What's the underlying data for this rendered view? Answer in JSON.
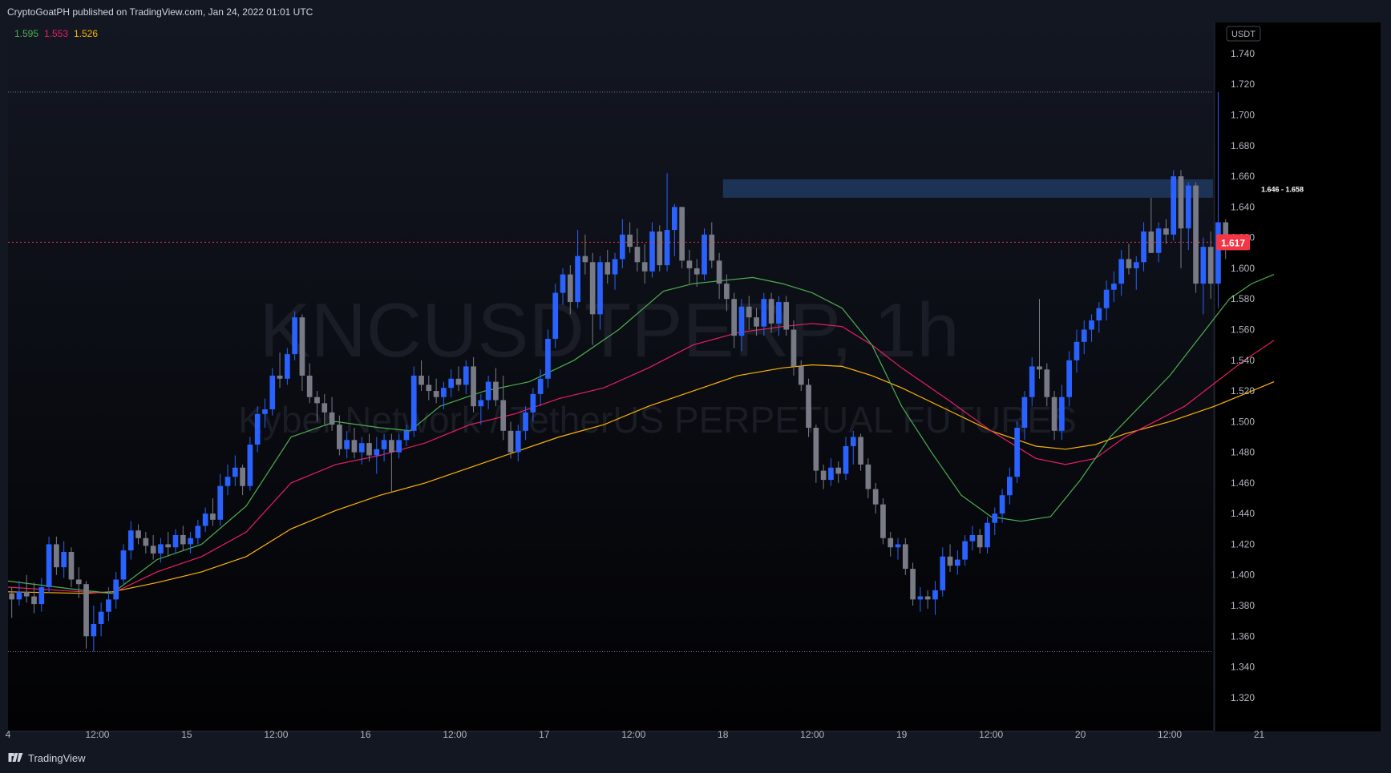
{
  "header": {
    "published_text": "CryptoGoatPH published on TradingView.com, Jan 24, 2022 01:01 UTC"
  },
  "footer": {
    "brand": "TradingView",
    "logo_icon": "tradingview-logo-icon"
  },
  "colors": {
    "background": "#000000",
    "up_candle": "#2962ff",
    "down_candle": "#787b86",
    "ema_fast": "#4caf50",
    "ema_mid": "#e91e63",
    "ema_slow": "#ffb300",
    "price_line": "#f23645",
    "zone": "#1e3a5f"
  },
  "chart_data": {
    "type": "candlestick",
    "watermark_symbol": "KNCUSDTPERP, 1h",
    "watermark_description": "Kyber Network / TetherUS PERPETUAL FUTURES",
    "currency": "USDT",
    "ylim": [
      1.31,
      1.752
    ],
    "y_ticks": [
      "1.740",
      "1.720",
      "1.700",
      "1.680",
      "1.660",
      "1.640",
      "1.620",
      "1.600",
      "1.580",
      "1.560",
      "1.540",
      "1.520",
      "1.500",
      "1.480",
      "1.460",
      "1.440",
      "1.420",
      "1.400",
      "1.380",
      "1.360",
      "1.340",
      "1.320"
    ],
    "x_ticks": [
      {
        "label": "4",
        "hour": 0
      },
      {
        "label": "12:00",
        "hour": 12
      },
      {
        "label": "15",
        "hour": 24
      },
      {
        "label": "12:00",
        "hour": 36
      },
      {
        "label": "16",
        "hour": 48
      },
      {
        "label": "12:00",
        "hour": 60
      },
      {
        "label": "17",
        "hour": 72
      },
      {
        "label": "12:00",
        "hour": 84
      },
      {
        "label": "18",
        "hour": 96
      },
      {
        "label": "12:00",
        "hour": 108
      },
      {
        "label": "19",
        "hour": 120
      },
      {
        "label": "12:00",
        "hour": 132
      },
      {
        "label": "20",
        "hour": 144
      },
      {
        "label": "12:00",
        "hour": 156
      },
      {
        "label": "21",
        "hour": 168
      }
    ],
    "x_range_hours": [
      0,
      180
    ],
    "ema_values": [
      {
        "name": "EMA fast",
        "value": "1.595",
        "color": "#4caf50"
      },
      {
        "name": "EMA mid",
        "value": "1.553",
        "color": "#e91e63"
      },
      {
        "name": "EMA slow",
        "value": "1.526",
        "color": "#ffb300"
      }
    ],
    "last_price": {
      "label": "1.617",
      "value": 1.617
    },
    "zone": {
      "label": "1.646 - 1.658",
      "low": 1.646,
      "high": 1.658,
      "start_hour": 96
    },
    "dotted_levels": [
      1.715,
      1.35
    ],
    "candles": [
      [
        1.388,
        1.392,
        1.372,
        1.384
      ],
      [
        1.384,
        1.396,
        1.38,
        1.389
      ],
      [
        1.389,
        1.4,
        1.382,
        1.386
      ],
      [
        1.386,
        1.395,
        1.375,
        1.381
      ],
      [
        1.381,
        1.398,
        1.376,
        1.392
      ],
      [
        1.392,
        1.425,
        1.388,
        1.42
      ],
      [
        1.42,
        1.425,
        1.4,
        1.405
      ],
      [
        1.405,
        1.422,
        1.398,
        1.415
      ],
      [
        1.415,
        1.418,
        1.392,
        1.397
      ],
      [
        1.397,
        1.405,
        1.385,
        1.394
      ],
      [
        1.394,
        1.396,
        1.352,
        1.36
      ],
      [
        1.36,
        1.38,
        1.35,
        1.368
      ],
      [
        1.368,
        1.382,
        1.36,
        1.376
      ],
      [
        1.376,
        1.392,
        1.37,
        1.384
      ],
      [
        1.384,
        1.402,
        1.378,
        1.397
      ],
      [
        1.397,
        1.42,
        1.394,
        1.416
      ],
      [
        1.416,
        1.435,
        1.41,
        1.429
      ],
      [
        1.429,
        1.433,
        1.42,
        1.424
      ],
      [
        1.424,
        1.428,
        1.414,
        1.419
      ],
      [
        1.419,
        1.426,
        1.41,
        1.414
      ],
      [
        1.414,
        1.424,
        1.408,
        1.42
      ],
      [
        1.42,
        1.428,
        1.412,
        1.418
      ],
      [
        1.418,
        1.43,
        1.414,
        1.426
      ],
      [
        1.426,
        1.432,
        1.416,
        1.42
      ],
      [
        1.42,
        1.428,
        1.414,
        1.424
      ],
      [
        1.424,
        1.436,
        1.42,
        1.432
      ],
      [
        1.432,
        1.444,
        1.428,
        1.44
      ],
      [
        1.44,
        1.45,
        1.432,
        1.436
      ],
      [
        1.436,
        1.466,
        1.432,
        1.458
      ],
      [
        1.458,
        1.472,
        1.452,
        1.464
      ],
      [
        1.464,
        1.478,
        1.458,
        1.47
      ],
      [
        1.47,
        1.472,
        1.452,
        1.458
      ],
      [
        1.458,
        1.49,
        1.455,
        1.485
      ],
      [
        1.485,
        1.51,
        1.48,
        1.505
      ],
      [
        1.505,
        1.515,
        1.496,
        1.508
      ],
      [
        1.508,
        1.535,
        1.504,
        1.53
      ],
      [
        1.53,
        1.545,
        1.522,
        1.528
      ],
      [
        1.528,
        1.548,
        1.524,
        1.544
      ],
      [
        1.544,
        1.572,
        1.54,
        1.568
      ],
      [
        1.568,
        1.57,
        1.52,
        1.53
      ],
      [
        1.53,
        1.538,
        1.512,
        1.516
      ],
      [
        1.516,
        1.52,
        1.5,
        1.512
      ],
      [
        1.512,
        1.518,
        1.498,
        1.506
      ],
      [
        1.506,
        1.516,
        1.494,
        1.498
      ],
      [
        1.498,
        1.504,
        1.478,
        1.482
      ],
      [
        1.482,
        1.494,
        1.476,
        1.488
      ],
      [
        1.488,
        1.496,
        1.476,
        1.48
      ],
      [
        1.48,
        1.49,
        1.472,
        1.486
      ],
      [
        1.486,
        1.492,
        1.474,
        1.478
      ],
      [
        1.478,
        1.49,
        1.466,
        1.482
      ],
      [
        1.482,
        1.492,
        1.474,
        1.488
      ],
      [
        1.488,
        1.492,
        1.454,
        1.48
      ],
      [
        1.48,
        1.492,
        1.476,
        1.488
      ],
      [
        1.488,
        1.498,
        1.484,
        1.494
      ],
      [
        1.494,
        1.536,
        1.49,
        1.53
      ],
      [
        1.53,
        1.54,
        1.52,
        1.524
      ],
      [
        1.524,
        1.53,
        1.514,
        1.52
      ],
      [
        1.52,
        1.528,
        1.512,
        1.516
      ],
      [
        1.516,
        1.526,
        1.508,
        1.522
      ],
      [
        1.522,
        1.534,
        1.516,
        1.528
      ],
      [
        1.528,
        1.536,
        1.52,
        1.524
      ],
      [
        1.524,
        1.54,
        1.518,
        1.536
      ],
      [
        1.536,
        1.542,
        1.506,
        1.51
      ],
      [
        1.51,
        1.518,
        1.498,
        1.514
      ],
      [
        1.514,
        1.53,
        1.508,
        1.526
      ],
      [
        1.526,
        1.535,
        1.51,
        1.514
      ],
      [
        1.514,
        1.53,
        1.488,
        1.494
      ],
      [
        1.494,
        1.5,
        1.476,
        1.48
      ],
      [
        1.48,
        1.498,
        1.474,
        1.494
      ],
      [
        1.494,
        1.51,
        1.488,
        1.506
      ],
      [
        1.506,
        1.522,
        1.5,
        1.518
      ],
      [
        1.518,
        1.534,
        1.51,
        1.528
      ],
      [
        1.528,
        1.56,
        1.522,
        1.554
      ],
      [
        1.554,
        1.59,
        1.548,
        1.584
      ],
      [
        1.584,
        1.6,
        1.576,
        1.596
      ],
      [
        1.596,
        1.602,
        1.57,
        1.578
      ],
      [
        1.578,
        1.625,
        1.574,
        1.608
      ],
      [
        1.608,
        1.622,
        1.596,
        1.604
      ],
      [
        1.604,
        1.61,
        1.55,
        1.57
      ],
      [
        1.57,
        1.608,
        1.56,
        1.604
      ],
      [
        1.604,
        1.612,
        1.59,
        1.596
      ],
      [
        1.596,
        1.61,
        1.586,
        1.606
      ],
      [
        1.606,
        1.632,
        1.6,
        1.622
      ],
      [
        1.622,
        1.63,
        1.61,
        1.614
      ],
      [
        1.614,
        1.626,
        1.598,
        1.604
      ],
      [
        1.604,
        1.616,
        1.59,
        1.598
      ],
      [
        1.598,
        1.63,
        1.594,
        1.624
      ],
      [
        1.624,
        1.628,
        1.598,
        1.602
      ],
      [
        1.602,
        1.662,
        1.598,
        1.625
      ],
      [
        1.625,
        1.642,
        1.608,
        1.64
      ],
      [
        1.64,
        1.64,
        1.6,
        1.605
      ],
      [
        1.605,
        1.612,
        1.59,
        1.6
      ],
      [
        1.6,
        1.606,
        1.588,
        1.596
      ],
      [
        1.596,
        1.626,
        1.592,
        1.622
      ],
      [
        1.622,
        1.63,
        1.6,
        1.605
      ],
      [
        1.605,
        1.61,
        1.58,
        1.59
      ],
      [
        1.59,
        1.596,
        1.572,
        1.58
      ],
      [
        1.58,
        1.584,
        1.548,
        1.556
      ],
      [
        1.556,
        1.58,
        1.546,
        1.575
      ],
      [
        1.575,
        1.582,
        1.56,
        1.568
      ],
      [
        1.568,
        1.574,
        1.556,
        1.562
      ],
      [
        1.562,
        1.584,
        1.556,
        1.58
      ],
      [
        1.58,
        1.584,
        1.558,
        1.564
      ],
      [
        1.564,
        1.582,
        1.556,
        1.578
      ],
      [
        1.578,
        1.582,
        1.556,
        1.56
      ],
      [
        1.56,
        1.566,
        1.53,
        1.536
      ],
      [
        1.536,
        1.54,
        1.52,
        1.524
      ],
      [
        1.524,
        1.528,
        1.49,
        1.496
      ],
      [
        1.496,
        1.498,
        1.46,
        1.468
      ],
      [
        1.468,
        1.472,
        1.456,
        1.462
      ],
      [
        1.462,
        1.476,
        1.458,
        1.47
      ],
      [
        1.47,
        1.474,
        1.46,
        1.466
      ],
      [
        1.466,
        1.49,
        1.462,
        1.484
      ],
      [
        1.484,
        1.494,
        1.472,
        1.49
      ],
      [
        1.49,
        1.492,
        1.468,
        1.472
      ],
      [
        1.472,
        1.476,
        1.45,
        1.456
      ],
      [
        1.456,
        1.46,
        1.44,
        1.446
      ],
      [
        1.446,
        1.45,
        1.42,
        1.424
      ],
      [
        1.424,
        1.428,
        1.412,
        1.418
      ],
      [
        1.418,
        1.424,
        1.41,
        1.42
      ],
      [
        1.42,
        1.424,
        1.4,
        1.404
      ],
      [
        1.404,
        1.408,
        1.38,
        1.384
      ],
      [
        1.384,
        1.392,
        1.376,
        1.386
      ],
      [
        1.386,
        1.39,
        1.378,
        1.384
      ],
      [
        1.384,
        1.396,
        1.374,
        1.39
      ],
      [
        1.39,
        1.418,
        1.386,
        1.412
      ],
      [
        1.412,
        1.42,
        1.402,
        1.406
      ],
      [
        1.406,
        1.416,
        1.4,
        1.41
      ],
      [
        1.41,
        1.426,
        1.406,
        1.422
      ],
      [
        1.422,
        1.432,
        1.416,
        1.426
      ],
      [
        1.426,
        1.43,
        1.414,
        1.418
      ],
      [
        1.418,
        1.438,
        1.414,
        1.434
      ],
      [
        1.434,
        1.444,
        1.426,
        1.44
      ],
      [
        1.44,
        1.456,
        1.434,
        1.452
      ],
      [
        1.452,
        1.47,
        1.446,
        1.464
      ],
      [
        1.464,
        1.5,
        1.46,
        1.496
      ],
      [
        1.496,
        1.52,
        1.488,
        1.516
      ],
      [
        1.516,
        1.542,
        1.51,
        1.536
      ],
      [
        1.536,
        1.58,
        1.528,
        1.534
      ],
      [
        1.534,
        1.538,
        1.51,
        1.516
      ],
      [
        1.516,
        1.52,
        1.488,
        1.494
      ],
      [
        1.494,
        1.524,
        1.488,
        1.516
      ],
      [
        1.516,
        1.546,
        1.51,
        1.54
      ],
      [
        1.54,
        1.56,
        1.532,
        1.552
      ],
      [
        1.552,
        1.566,
        1.544,
        1.56
      ],
      [
        1.56,
        1.57,
        1.552,
        1.566
      ],
      [
        1.566,
        1.578,
        1.558,
        1.574
      ],
      [
        1.574,
        1.592,
        1.566,
        1.586
      ],
      [
        1.586,
        1.598,
        1.578,
        1.59
      ],
      [
        1.59,
        1.612,
        1.582,
        1.606
      ],
      [
        1.606,
        1.616,
        1.596,
        1.6
      ],
      [
        1.6,
        1.608,
        1.586,
        1.604
      ],
      [
        1.604,
        1.63,
        1.598,
        1.624
      ],
      [
        1.624,
        1.646,
        1.614,
        1.61
      ],
      [
        1.61,
        1.63,
        1.604,
        1.626
      ],
      [
        1.626,
        1.632,
        1.616,
        1.622
      ],
      [
        1.622,
        1.664,
        1.618,
        1.66
      ],
      [
        1.66,
        1.664,
        1.6,
        1.626
      ],
      [
        1.626,
        1.656,
        1.612,
        1.654
      ],
      [
        1.654,
        1.656,
        1.584,
        1.59
      ],
      [
        1.59,
        1.62,
        1.57,
        1.614
      ],
      [
        1.614,
        1.624,
        1.58,
        1.59
      ],
      [
        1.59,
        1.715,
        1.574,
        1.63
      ],
      [
        1.63,
        1.632,
        1.606,
        1.617
      ]
    ],
    "ema_fast": [
      [
        0,
        1.396
      ],
      [
        10,
        1.39
      ],
      [
        14,
        1.388
      ],
      [
        20,
        1.41
      ],
      [
        26,
        1.42
      ],
      [
        32,
        1.445
      ],
      [
        38,
        1.49
      ],
      [
        44,
        1.5
      ],
      [
        50,
        1.496
      ],
      [
        54,
        1.494
      ],
      [
        58,
        1.51
      ],
      [
        64,
        1.52
      ],
      [
        70,
        1.526
      ],
      [
        76,
        1.54
      ],
      [
        82,
        1.56
      ],
      [
        88,
        1.585
      ],
      [
        92,
        1.59
      ],
      [
        96,
        1.592
      ],
      [
        100,
        1.594
      ],
      [
        104,
        1.59
      ],
      [
        108,
        1.584
      ],
      [
        112,
        1.574
      ],
      [
        116,
        1.55
      ],
      [
        120,
        1.51
      ],
      [
        124,
        1.48
      ],
      [
        128,
        1.452
      ],
      [
        132,
        1.438
      ],
      [
        136,
        1.435
      ],
      [
        140,
        1.438
      ],
      [
        144,
        1.462
      ],
      [
        148,
        1.49
      ],
      [
        152,
        1.51
      ],
      [
        156,
        1.53
      ],
      [
        160,
        1.555
      ],
      [
        164,
        1.58
      ],
      [
        167,
        1.59
      ],
      [
        170,
        1.596
      ]
    ],
    "ema_mid": [
      [
        0,
        1.392
      ],
      [
        10,
        1.389
      ],
      [
        14,
        1.388
      ],
      [
        20,
        1.402
      ],
      [
        26,
        1.412
      ],
      [
        32,
        1.428
      ],
      [
        38,
        1.46
      ],
      [
        44,
        1.472
      ],
      [
        50,
        1.478
      ],
      [
        56,
        1.486
      ],
      [
        62,
        1.498
      ],
      [
        68,
        1.505
      ],
      [
        74,
        1.515
      ],
      [
        80,
        1.522
      ],
      [
        86,
        1.535
      ],
      [
        92,
        1.55
      ],
      [
        98,
        1.558
      ],
      [
        104,
        1.562
      ],
      [
        108,
        1.564
      ],
      [
        112,
        1.562
      ],
      [
        116,
        1.55
      ],
      [
        120,
        1.535
      ],
      [
        126,
        1.515
      ],
      [
        132,
        1.494
      ],
      [
        138,
        1.476
      ],
      [
        142,
        1.472
      ],
      [
        146,
        1.476
      ],
      [
        150,
        1.49
      ],
      [
        154,
        1.5
      ],
      [
        158,
        1.51
      ],
      [
        162,
        1.525
      ],
      [
        166,
        1.54
      ],
      [
        170,
        1.553
      ]
    ],
    "ema_slow": [
      [
        0,
        1.389
      ],
      [
        10,
        1.388
      ],
      [
        14,
        1.389
      ],
      [
        20,
        1.395
      ],
      [
        26,
        1.402
      ],
      [
        32,
        1.412
      ],
      [
        38,
        1.43
      ],
      [
        44,
        1.442
      ],
      [
        50,
        1.452
      ],
      [
        56,
        1.46
      ],
      [
        62,
        1.47
      ],
      [
        68,
        1.48
      ],
      [
        74,
        1.49
      ],
      [
        80,
        1.498
      ],
      [
        86,
        1.51
      ],
      [
        92,
        1.52
      ],
      [
        98,
        1.53
      ],
      [
        104,
        1.535
      ],
      [
        108,
        1.537
      ],
      [
        112,
        1.536
      ],
      [
        116,
        1.53
      ],
      [
        120,
        1.522
      ],
      [
        126,
        1.508
      ],
      [
        132,
        1.494
      ],
      [
        138,
        1.484
      ],
      [
        142,
        1.482
      ],
      [
        146,
        1.485
      ],
      [
        150,
        1.492
      ],
      [
        156,
        1.5
      ],
      [
        162,
        1.51
      ],
      [
        166,
        1.518
      ],
      [
        170,
        1.526
      ]
    ]
  }
}
